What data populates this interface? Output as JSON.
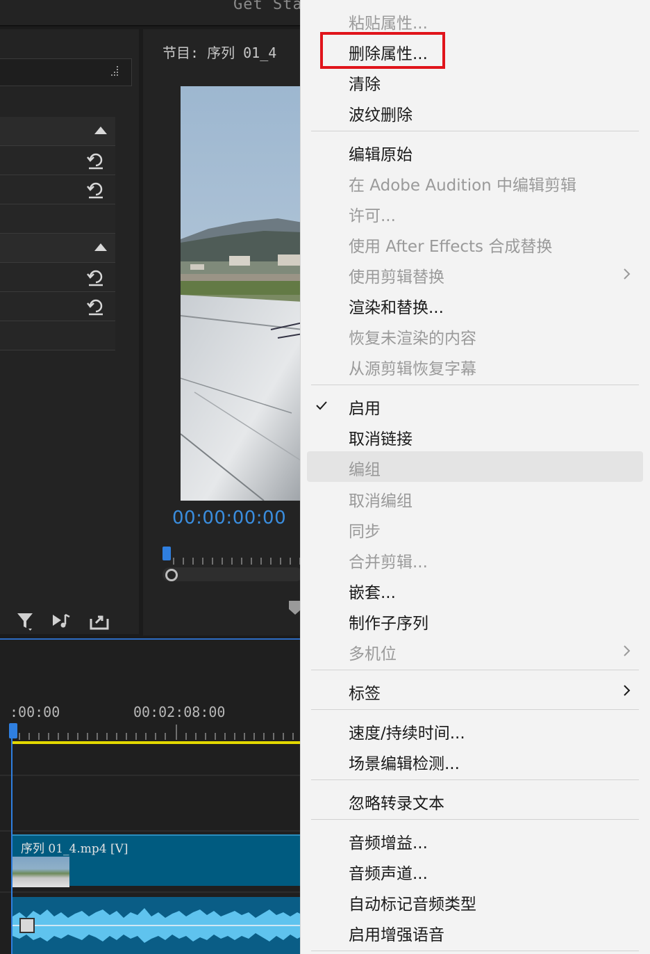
{
  "header": {
    "get_started": "Get Sta"
  },
  "program": {
    "title": "节目: 序列 01_4",
    "timecode": "00:00:00:00"
  },
  "timeline": {
    "time_start": ":00:00",
    "time_mid": "00:02:08:00",
    "clip_label": "序列 01_4.mp4 [V]"
  },
  "menu": {
    "highlighted_item": "删除属性...",
    "groups": [
      [
        {
          "label": "粘贴属性...",
          "enabled": false
        },
        {
          "label": "删除属性...",
          "enabled": true
        },
        {
          "label": "清除",
          "enabled": true
        },
        {
          "label": "波纹删除",
          "enabled": true
        }
      ],
      [
        {
          "label": "编辑原始",
          "enabled": true
        },
        {
          "label": "在 Adobe Audition 中编辑剪辑",
          "enabled": false
        },
        {
          "label": "许可...",
          "enabled": false
        },
        {
          "label": "使用 After Effects 合成替换",
          "enabled": false
        },
        {
          "label": "使用剪辑替换",
          "enabled": false,
          "submenu": true
        },
        {
          "label": "渲染和替换...",
          "enabled": true
        },
        {
          "label": "恢复未渲染的内容",
          "enabled": false
        },
        {
          "label": "从源剪辑恢复字幕",
          "enabled": false
        }
      ],
      [
        {
          "label": "启用",
          "enabled": true,
          "checked": true
        },
        {
          "label": "取消链接",
          "enabled": true
        },
        {
          "label": "编组",
          "enabled": false,
          "hovered": true
        },
        {
          "label": "取消编组",
          "enabled": false
        },
        {
          "label": "同步",
          "enabled": false
        },
        {
          "label": "合并剪辑...",
          "enabled": false
        },
        {
          "label": "嵌套...",
          "enabled": true
        },
        {
          "label": "制作子序列",
          "enabled": true
        },
        {
          "label": "多机位",
          "enabled": false,
          "submenu": true
        }
      ],
      [
        {
          "label": "标签",
          "enabled": true,
          "submenu": true
        }
      ],
      [
        {
          "label": "速度/持续时间...",
          "enabled": true
        },
        {
          "label": "场景编辑检测...",
          "enabled": true
        }
      ],
      [
        {
          "label": "忽略转录文本",
          "enabled": true
        }
      ],
      [
        {
          "label": "音频增益...",
          "enabled": true
        },
        {
          "label": "音频声道...",
          "enabled": true
        },
        {
          "label": "自动标记音频类型",
          "enabled": true
        },
        {
          "label": "启用增强语音",
          "enabled": true
        }
      ]
    ]
  },
  "colors": {
    "highlight_border": "#e0141b",
    "timecode_blue": "#3a8dde",
    "timeline_yellow": "#e3d800",
    "video_clip": "#005b80"
  },
  "icons": [
    "grip-icon",
    "collapse-triangle-icon",
    "reset-icon",
    "filter-icon",
    "insert-audio-icon",
    "export-icon",
    "checkmark-icon",
    "submenu-arrow-icon",
    "marker-icon"
  ]
}
